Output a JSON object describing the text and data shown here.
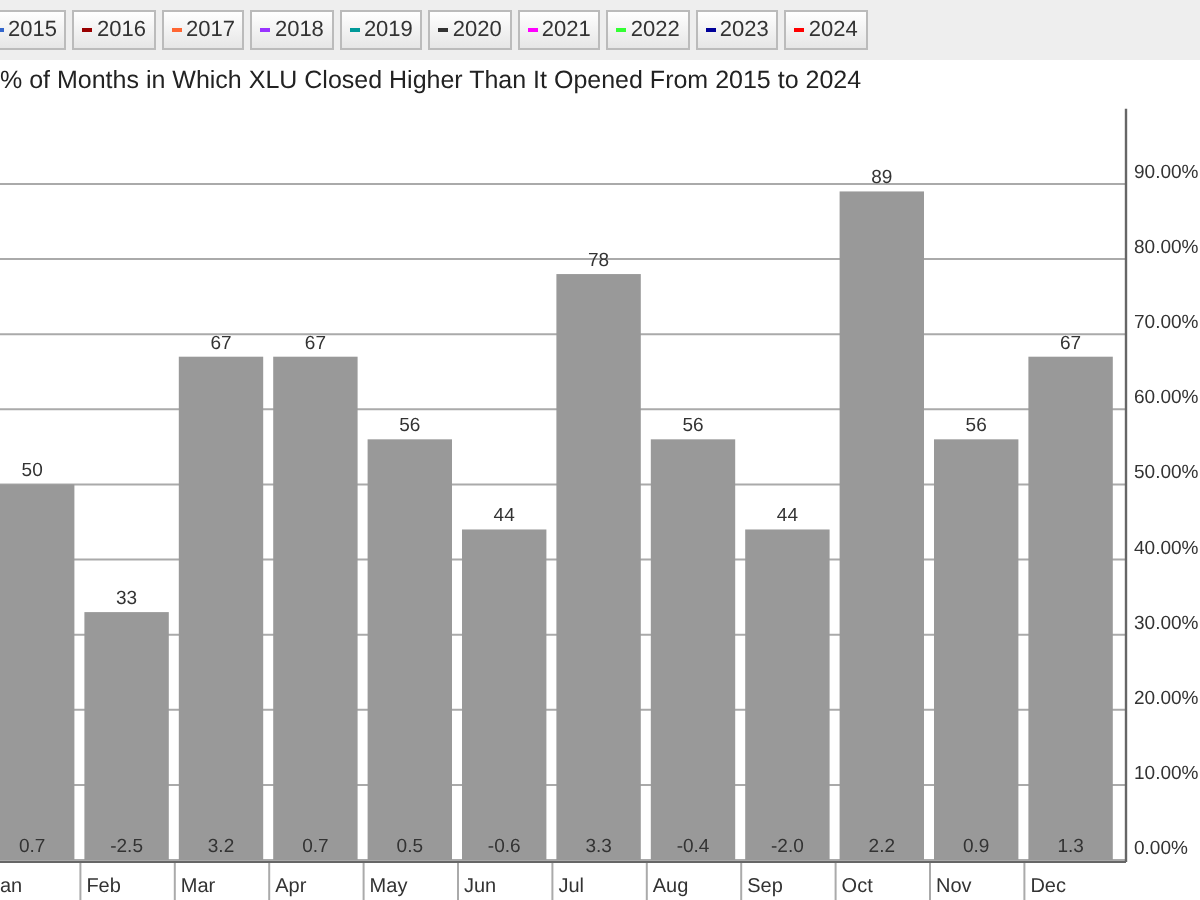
{
  "legend": [
    {
      "label": "2015",
      "color": "#3366cc"
    },
    {
      "label": "2016",
      "color": "#990000"
    },
    {
      "label": "2017",
      "color": "#ff6633"
    },
    {
      "label": "2018",
      "color": "#9933ff"
    },
    {
      "label": "2019",
      "color": "#009999"
    },
    {
      "label": "2020",
      "color": "#333333"
    },
    {
      "label": "2021",
      "color": "#ff00ff"
    },
    {
      "label": "2022",
      "color": "#33ff33"
    },
    {
      "label": "2023",
      "color": "#000099"
    },
    {
      "label": "2024",
      "color": "#ff0000"
    }
  ],
  "chart": {
    "title": "% of Months in Which XLU Closed Higher Than It Opened From 2015 to 2024",
    "chart_data": {
      "type": "bar",
      "categories": [
        "an",
        "Feb",
        "Mar",
        "Apr",
        "May",
        "Jun",
        "Jul",
        "Aug",
        "Sep",
        "Oct",
        "Nov",
        "Dec"
      ],
      "values": [
        50,
        33,
        67,
        67,
        56,
        44,
        78,
        56,
        44,
        89,
        56,
        67
      ],
      "ylim": [
        0,
        100
      ],
      "grid": true,
      "yticks": [
        {
          "value": 0,
          "label": "0.00%"
        },
        {
          "value": 10,
          "label": "10.00%"
        },
        {
          "value": 20,
          "label": "20.00%"
        },
        {
          "value": 30,
          "label": "30.00%"
        },
        {
          "value": 40,
          "label": "40.00%"
        },
        {
          "value": 50,
          "label": "50.00%"
        },
        {
          "value": 60,
          "label": "60.00%"
        },
        {
          "value": 70,
          "label": "70.00%"
        },
        {
          "value": 80,
          "label": "80.00%"
        },
        {
          "value": 90,
          "label": "90.00%"
        }
      ],
      "data_labels": true
    },
    "bar_footers": [
      "0.7",
      "-2.5",
      "3.2",
      "0.7",
      "0.5",
      "-0.6",
      "3.3",
      "-0.4",
      "-2.0",
      "2.2",
      "0.9",
      "1.3"
    ]
  }
}
